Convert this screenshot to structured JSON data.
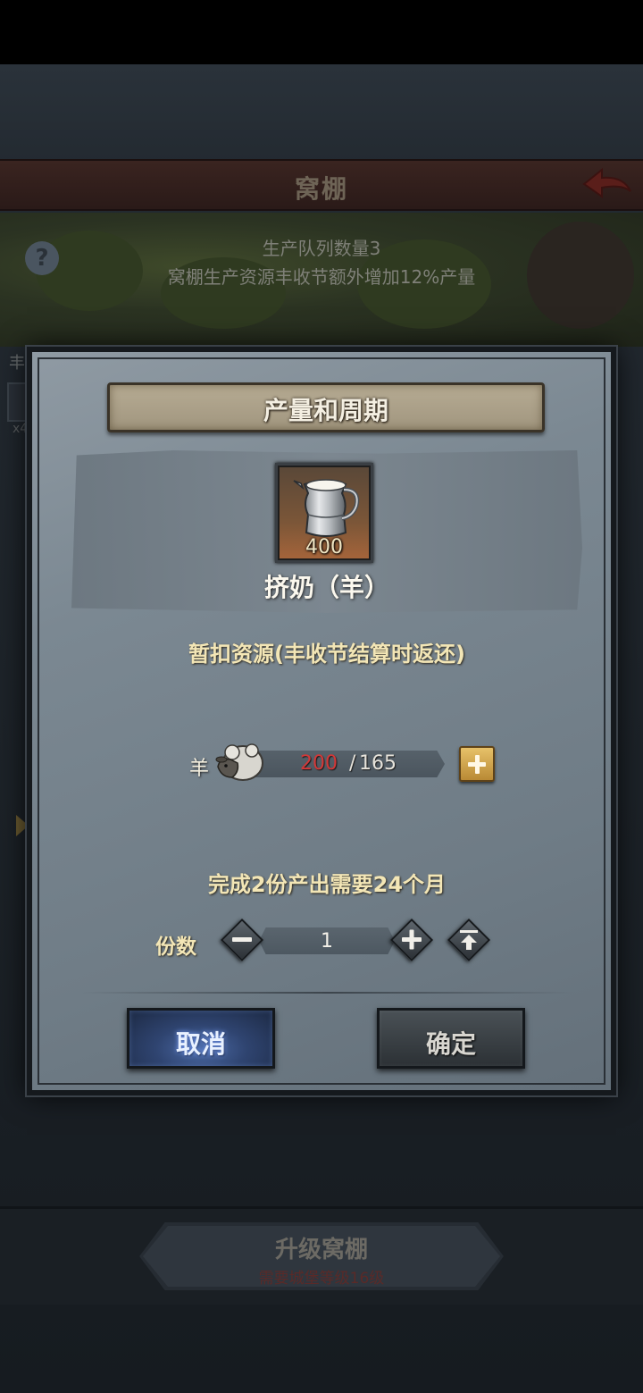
{
  "background": {
    "title": "窝棚",
    "info_line1": "生产队列数量3",
    "info_line2": "窝棚生产资源丰收节额外增加12%产量",
    "left_text": "丰",
    "left_count": "x4",
    "upgrade_button": "升级窝棚",
    "upgrade_requirement": "需要城堡等级16级"
  },
  "dialog": {
    "title": "产量和周期",
    "product": {
      "icon": "milk-jug-icon",
      "quantity": "400",
      "name": "挤奶（羊）"
    },
    "deduct_label": "暂扣资源(丰收节结算时返还)",
    "resource": {
      "name": "羊",
      "icon": "sheep-icon",
      "have": "200",
      "separator": "/",
      "need": "165"
    },
    "duration_text": "完成2份产出需要24个月",
    "quantity_label": "份数",
    "quantity_value": "1",
    "cancel_label": "取消",
    "confirm_label": "确定"
  },
  "colors": {
    "accent_gold": "#f3e6b6",
    "insufficient_red": "#d23838",
    "cancel_blue": "#4c6aa6"
  }
}
